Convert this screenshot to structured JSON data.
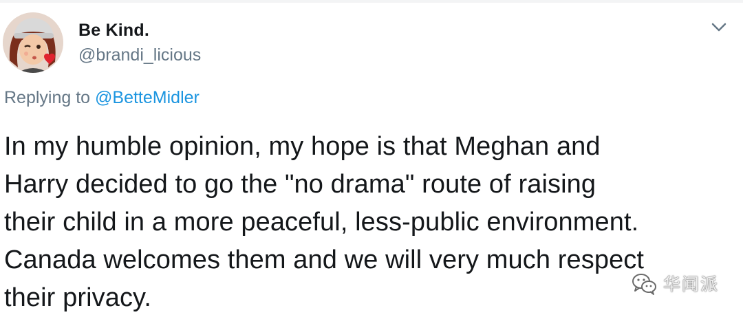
{
  "tweet": {
    "display_name": "Be Kind.",
    "handle": "@brandi_licious",
    "reply_prefix": "Replying to",
    "reply_to": "@BetteMidler",
    "text": "In my humble opinion, my hope is that Meghan and\nHarry decided to go the \"no drama\" route of raising\ntheir child in a more peaceful, less-public environment.\nCanada welcomes them and we will very much respect\ntheir privacy.",
    "avatar_icon": "memoji-avatar-icon",
    "menu_icon": "chevron-down-icon"
  },
  "watermark": {
    "text": "华闻派",
    "icon": "wechat-icon"
  },
  "colors": {
    "text": "#14171a",
    "secondary": "#657786",
    "link": "#1b95e0"
  }
}
